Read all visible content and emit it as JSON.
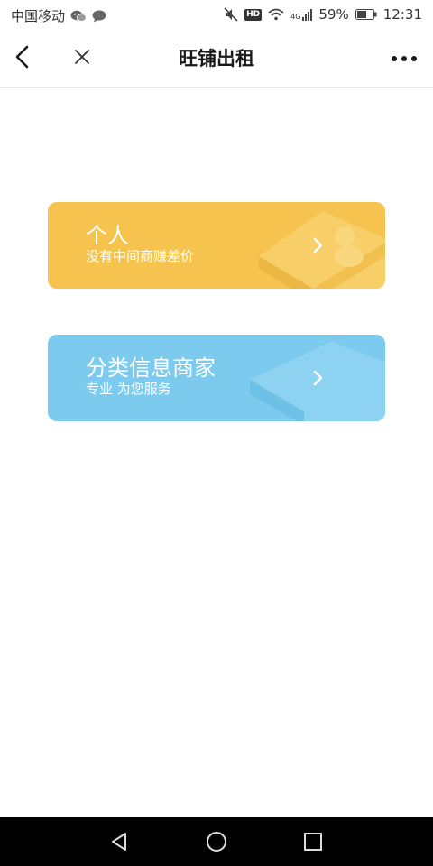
{
  "status_bar": {
    "carrier": "中国移动",
    "network": "4G",
    "battery_percent": "59%",
    "battery_level": 0.59,
    "time": "12:31",
    "hd_label": "HD"
  },
  "nav": {
    "title": "旺铺出租"
  },
  "cards": [
    {
      "title": "个人",
      "subtitle": "没有中间商赚差价",
      "color": "#f5c34e"
    },
    {
      "title": "分类信息商家",
      "subtitle": "专业 为您服务",
      "color": "#7ccbee"
    }
  ],
  "colors": {
    "personal_accent": "#f5c34e",
    "merchant_accent": "#7ccbee",
    "system_nav": "#000000"
  },
  "icons": {
    "back": "chevron-left",
    "close": "x",
    "more": "ellipsis",
    "card_arrow": "chevron-right",
    "system_back": "triangle",
    "system_home": "circle",
    "system_recents": "square"
  }
}
